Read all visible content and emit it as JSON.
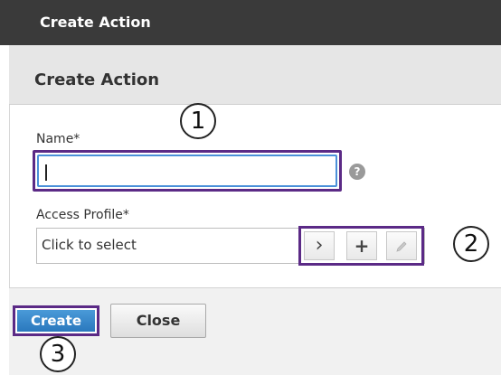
{
  "window": {
    "title": "Create Action"
  },
  "panel": {
    "heading": "Create Action"
  },
  "form": {
    "name_label": "Name*",
    "name_value": "",
    "help_glyph": "?",
    "profile_label": "Access Profile*",
    "profile_placeholder": "Click to select",
    "profile_buttons": {
      "select_glyph": "›",
      "add_glyph": "+",
      "edit_icon": "pencil-icon"
    }
  },
  "footer": {
    "create_label": "Create",
    "close_label": "Close"
  },
  "callouts": [
    "1",
    "2",
    "3"
  ],
  "colors": {
    "highlight": "#5b2a86",
    "primary": "#2a78bd",
    "titlebar": "#3a3a3a"
  }
}
